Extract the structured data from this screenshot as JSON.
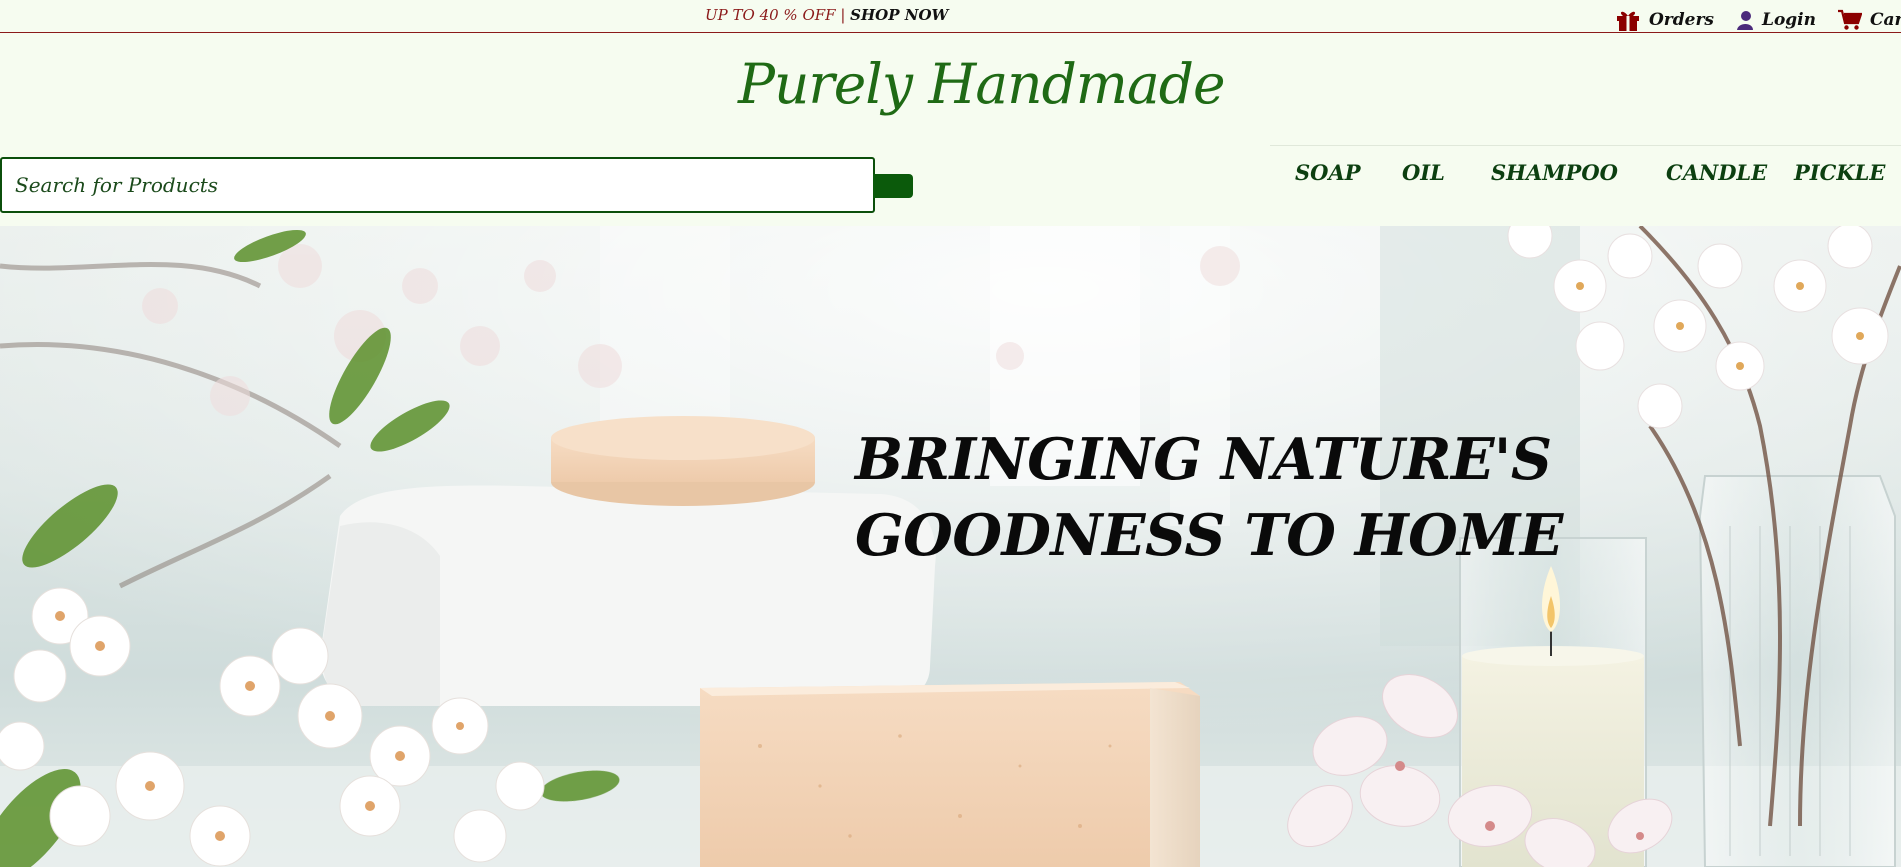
{
  "promo": {
    "text": "UP TO 40 % OFF | ",
    "link": "SHOP NOW"
  },
  "topnav": [
    {
      "label": "Orders",
      "icon": "gift-icon"
    },
    {
      "label": "Login",
      "icon": "user-icon"
    },
    {
      "label": "Cart",
      "icon": "cart-icon"
    }
  ],
  "brand": "Purely Handmade",
  "search": {
    "placeholder": "Search for Products",
    "value": ""
  },
  "nav": [
    "SOAP",
    "OIL",
    "SHAMPOO",
    "CANDLE",
    "PICKLE"
  ],
  "hero": {
    "line1": "BRINGING NATURE'S",
    "line2": "GOODNESS TO HOME"
  },
  "colors": {
    "brand_green": "#1f6a15",
    "promo_red": "#8b1a1a",
    "icon_red": "#8b0000",
    "nav_green": "#0c3f10",
    "background": "#f6fcf0"
  }
}
